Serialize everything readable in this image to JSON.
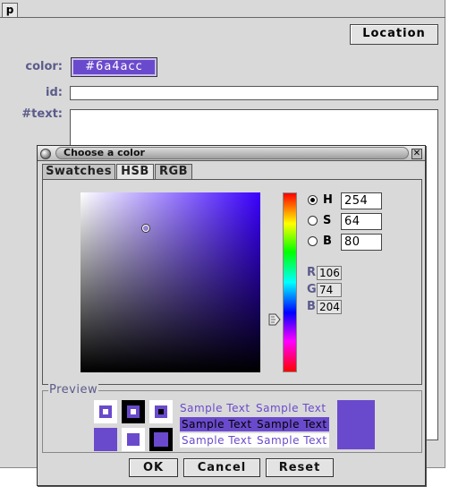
{
  "background": {
    "tab_label": "p",
    "location_button": "Location",
    "labels": {
      "color": "color:",
      "id": "id:",
      "text": "#text:"
    },
    "color_value": "#6a4acc",
    "id_value": "",
    "text_value": ""
  },
  "dialog": {
    "title": "Choose a color",
    "close_glyph": "✕",
    "tabs": [
      {
        "label": "Swatches",
        "active": false
      },
      {
        "label": "HSB",
        "active": true
      },
      {
        "label": "RGB",
        "active": false
      }
    ],
    "hsb": {
      "h_label": "H",
      "h_value": "254",
      "s_label": "S",
      "s_value": "64",
      "b_label": "B",
      "b_value": "80",
      "selected": "H"
    },
    "rgb": {
      "r_label": "R",
      "r_value": "106",
      "g_label": "G",
      "g_value": "74",
      "b_label": "B",
      "b_value": "204"
    },
    "preview": {
      "label": "Preview",
      "sample_text": "Sample Text",
      "color": "#6a4acc"
    },
    "buttons": {
      "ok": "OK",
      "cancel": "Cancel",
      "reset": "Reset"
    }
  },
  "colors": {
    "selected": "#6a4acc",
    "label_blue": "#5b5b8c"
  }
}
